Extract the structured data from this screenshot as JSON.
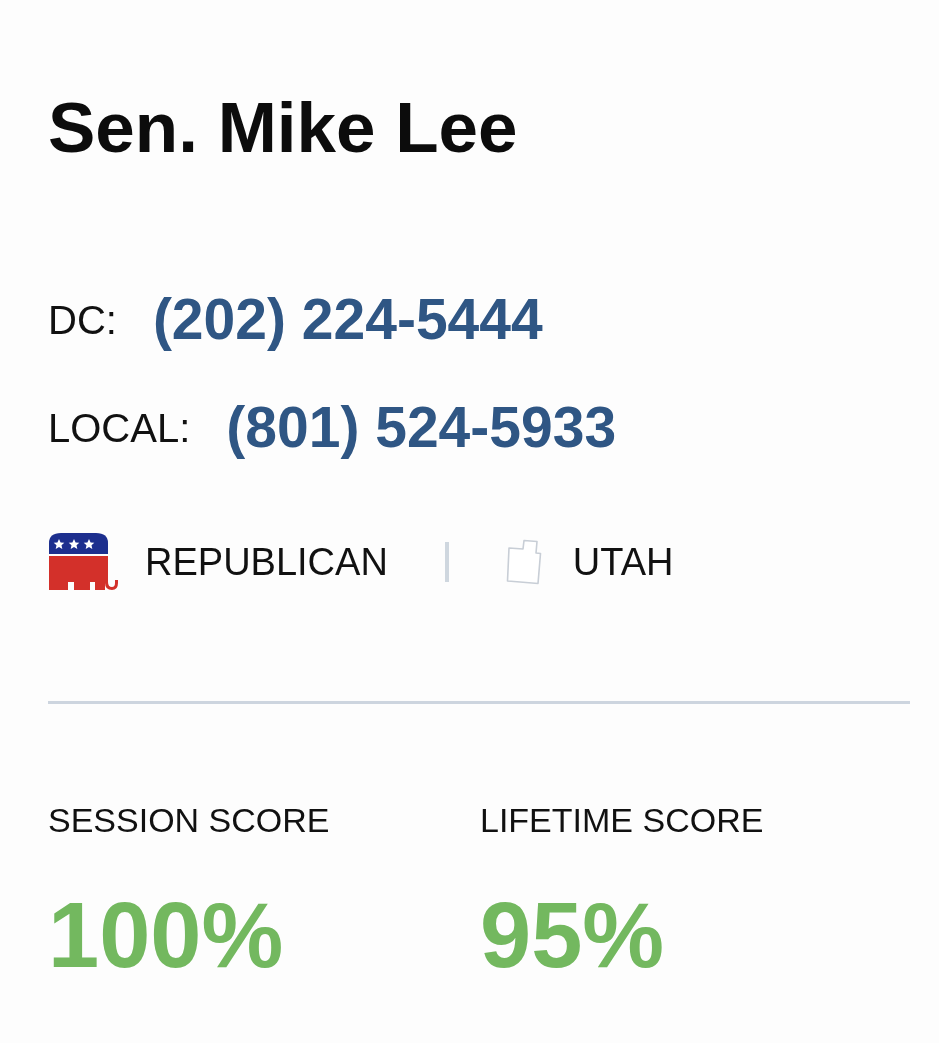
{
  "senator": {
    "name": "Sen. Mike Lee"
  },
  "phones": [
    {
      "label": "DC:",
      "number": "(202) 224-5444"
    },
    {
      "label": "LOCAL:",
      "number": "(801) 524-5933"
    }
  ],
  "affiliation": {
    "party": "REPUBLICAN",
    "state": "UTAH"
  },
  "scores": [
    {
      "label": "SESSION SCORE",
      "value": "100%"
    },
    {
      "label": "LIFETIME SCORE",
      "value": "95%"
    }
  ]
}
